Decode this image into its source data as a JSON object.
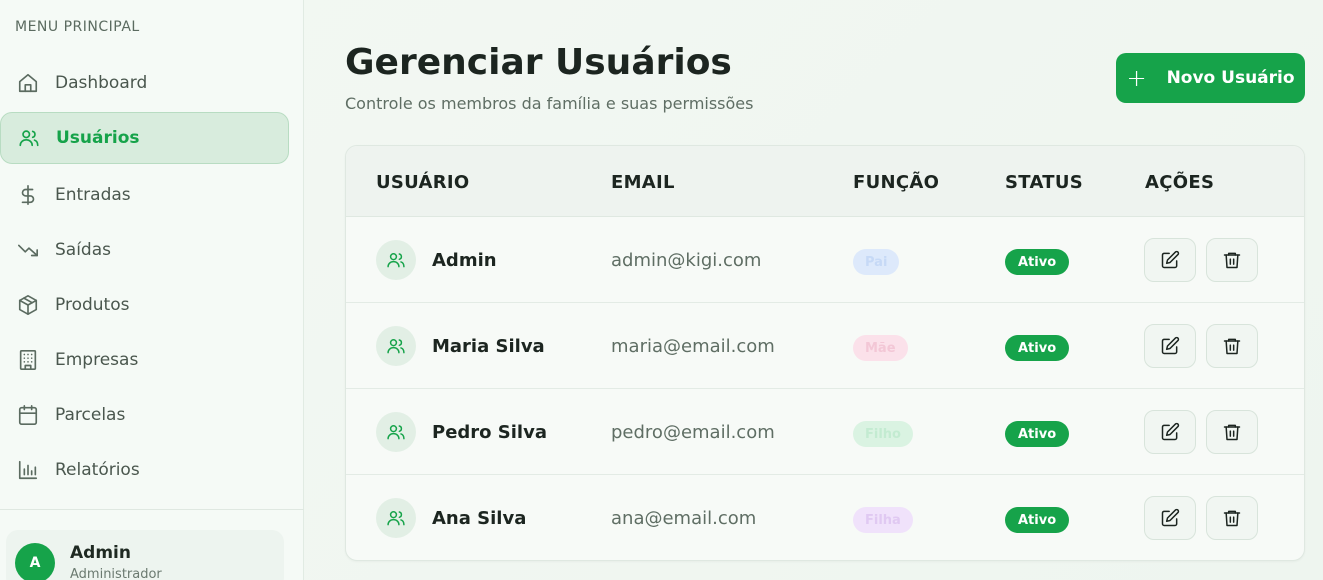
{
  "sidebar": {
    "menu_title": "MENU PRINCIPAL",
    "items": [
      {
        "label": "Dashboard",
        "icon": "home-icon"
      },
      {
        "label": "Usuários",
        "icon": "users-icon",
        "active": true
      },
      {
        "label": "Entradas",
        "icon": "dollar-icon"
      },
      {
        "label": "Saídas",
        "icon": "trending-down-icon"
      },
      {
        "label": "Produtos",
        "icon": "box-icon"
      },
      {
        "label": "Empresas",
        "icon": "building-icon"
      },
      {
        "label": "Parcelas",
        "icon": "calendar-icon"
      },
      {
        "label": "Relatórios",
        "icon": "bar-chart-icon"
      }
    ],
    "user": {
      "initial": "A",
      "name": "Admin",
      "role": "Administrador"
    }
  },
  "header": {
    "title": "Gerenciar Usuários",
    "subtitle": "Controle os membros da família e suas permissões",
    "new_button_label": "Novo Usuário"
  },
  "table": {
    "columns": [
      "USUÁRIO",
      "EMAIL",
      "FUNÇÃO",
      "STATUS",
      "AÇÕES"
    ],
    "rows": [
      {
        "name": "Admin",
        "email": "admin@kigi.com",
        "role": "Pai",
        "status": "Ativo"
      },
      {
        "name": "Maria Silva",
        "email": "maria@email.com",
        "role": "Mãe",
        "status": "Ativo"
      },
      {
        "name": "Pedro Silva",
        "email": "pedro@email.com",
        "role": "Filho",
        "status": "Ativo"
      },
      {
        "name": "Ana Silva",
        "email": "ana@email.com",
        "role": "Filha",
        "status": "Ativo"
      }
    ]
  },
  "colors": {
    "accent": "#16a34a",
    "role_pai_bg": "#dde9fb",
    "role_pai_fg": "#cfe0f8",
    "role_mae_bg": "#fbe1ea",
    "role_mae_fg": "#f5ccdb",
    "role_filho_bg": "#daf3e2",
    "role_filho_fg": "#c7ecd4",
    "role_filha_bg": "#f0e2fb",
    "role_filha_fg": "#e3ccf5"
  }
}
